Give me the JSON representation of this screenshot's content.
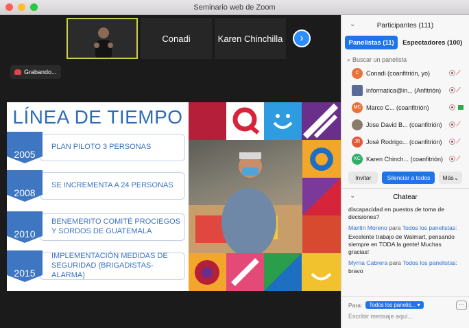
{
  "window": {
    "title": "Seminario web de Zoom"
  },
  "colors": {
    "accent": "#1f74ea",
    "record": "#e64545",
    "slide_blue": "#3f76c1"
  },
  "thumbnails": [
    {
      "label": ""
    },
    {
      "label": "Conadi"
    },
    {
      "label": "Karen Chinchilla"
    }
  ],
  "next_icon": "chevron-right-icon",
  "recording": {
    "label": "Grabando..."
  },
  "slide": {
    "title": "LÍNEA DE TIEMPO",
    "timeline": [
      {
        "year": "2005",
        "text": "PLAN PILOTO 3 PERSONAS"
      },
      {
        "year": "2008",
        "text": "SE INCREMENTA A 24 PERSONAS"
      },
      {
        "year": "2010",
        "text": "BENEMERITO COMITÉ PROCIEGOS Y SORDOS DE GUATEMALA"
      },
      {
        "year": "2015",
        "text": "IMPLEMENTACIÓN MEDIDAS DE SEGURIDAD (BRIGADISTAS-ALARMA)"
      }
    ]
  },
  "participants": {
    "header": "Participantes (111)",
    "tabs": [
      {
        "label": "Panelistas (11)"
      },
      {
        "label": "Espectadores (100)"
      }
    ],
    "search_placeholder": "Buscar un panelista",
    "rows": [
      {
        "initials": "C",
        "name": "Conadi (coanfitrión, yo)",
        "color": "#e8733a"
      },
      {
        "initials": "",
        "name": "informatica@in... (Anfitrión)",
        "color": "#5a6a9a"
      },
      {
        "initials": "MC",
        "name": "Marco C... (coanfitrión)",
        "color": "#e8733a"
      },
      {
        "initials": "",
        "name": "Jose David B... (coanfitrión)",
        "color": "#8a7a6a"
      },
      {
        "initials": "JR",
        "name": "José Rodrigo... (coanfitrión)",
        "color": "#e05a3a"
      },
      {
        "initials": "KC",
        "name": "Karen Chinch... (coanfitrión)",
        "color": "#2fae6a"
      }
    ],
    "buttons": {
      "invite": "Invitar",
      "mute_all": "Silenciar a todos",
      "more": "Más"
    }
  },
  "chat": {
    "header": "Chatear",
    "first_message": "discapacidad en puestos de toma de decisiones?",
    "messages": [
      {
        "from": "Marilin Moreno",
        "to_word": "para",
        "to": "Todos los panelistas:",
        "text": "Excelente trabajo de Walmart, pensando siempre en TODA la gente! Muchas gracias!"
      },
      {
        "from": "Myrna Cabrera",
        "to_word": "para",
        "to": "Todos los panelistas:",
        "text": "bravo"
      }
    ],
    "to_label": "Para:",
    "to_value": "Todos los panelis...",
    "input_placeholder": "Escribir mensaje aquí..."
  }
}
